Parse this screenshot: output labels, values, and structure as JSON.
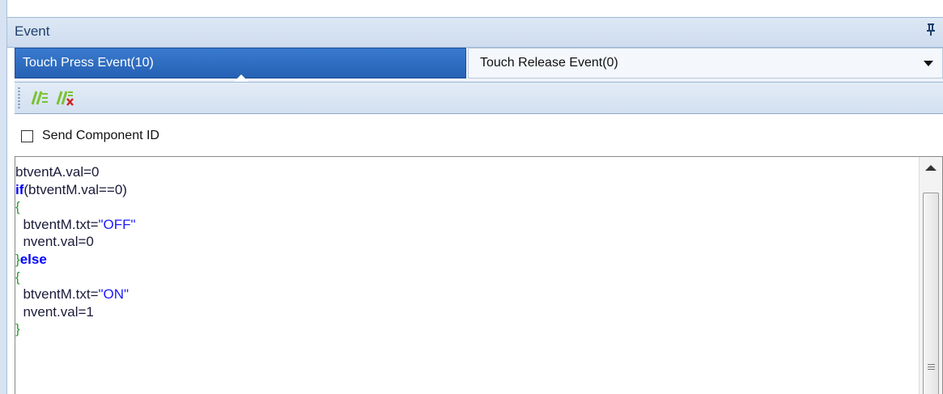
{
  "panel": {
    "title": "Event"
  },
  "tabs": [
    {
      "label": "Touch Press Event(10)",
      "active": true
    },
    {
      "label": "Touch Release Event(0)",
      "active": false
    }
  ],
  "toolbar": {
    "buttons": [
      {
        "icon": "comment-lines-icon"
      },
      {
        "icon": "uncomment-lines-icon"
      }
    ]
  },
  "options": {
    "send_component_id_label": "Send Component ID",
    "send_component_id_checked": false
  },
  "editor": {
    "lines": [
      "btventA.val=0",
      "if(btventM.val==0)",
      "{",
      "  btventM.txt=\"OFF\"",
      "  nvent.val=0",
      "}else",
      "{",
      "  btventM.txt=\"ON\"",
      "  nvent.val=1",
      "}"
    ]
  },
  "colors": {
    "active_tab": "#2c68bd",
    "keyword": "#0000ff",
    "string": "#1a1aff",
    "brace": "#2a9a2a",
    "toolbar_icon": "#7cc234",
    "delete_mark": "#d22020"
  }
}
